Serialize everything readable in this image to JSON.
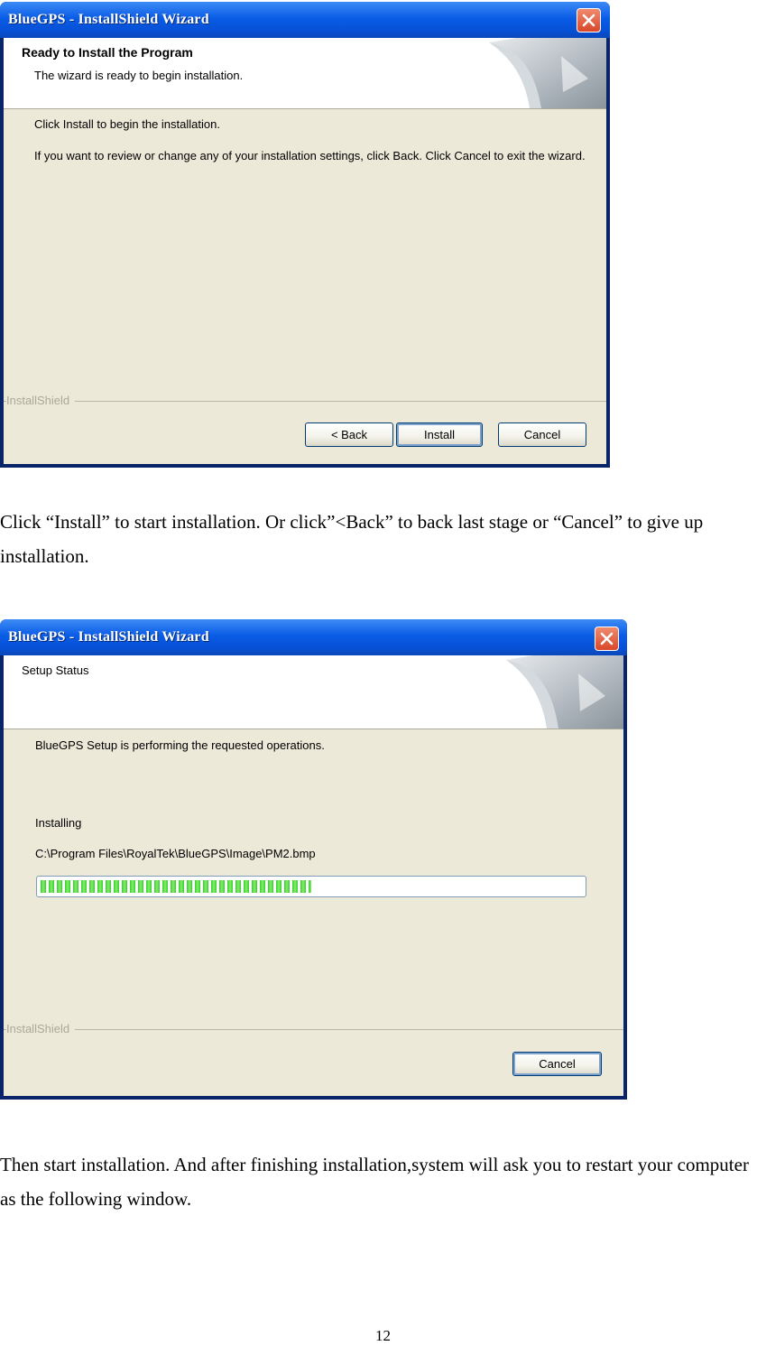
{
  "window1": {
    "title": "BlueGPS - InstallShield Wizard",
    "header_title": "Ready to Install the Program",
    "header_subtitle": "The wizard is ready to begin installation.",
    "line1": "Click Install to begin the installation.",
    "line2": "If you want to review or change any of your installation settings, click Back. Click Cancel to exit the wizard.",
    "brand": "InstallShield",
    "back_label": "< Back",
    "install_label": "Install",
    "cancel_label": "Cancel"
  },
  "paragraph1": "Click “Install” to start installation. Or click”<Back” to back last stage or “Cancel” to give up installation.",
  "window2": {
    "title": "BlueGPS - InstallShield Wizard",
    "header_subtitle": "Setup Status",
    "line1": "BlueGPS Setup is performing the requested operations.",
    "status_label": "Installing",
    "file_path": "C:\\Program Files\\RoyalTek\\BlueGPS\\Image\\PM2.bmp",
    "progress": 0.5,
    "brand": "InstallShield",
    "cancel_label": "Cancel"
  },
  "paragraph2": "Then start installation. And after finishing installation,system will ask you to restart your computer as the following window.",
  "page_number": "12",
  "colors": {
    "titlebar": "#0a5ce6",
    "dialog_bg": "#ece9d8",
    "progress_fill": "#2dd22d",
    "close": "#d9472a"
  },
  "icons": [
    "close-icon",
    "wizard-corner-graphic"
  ]
}
